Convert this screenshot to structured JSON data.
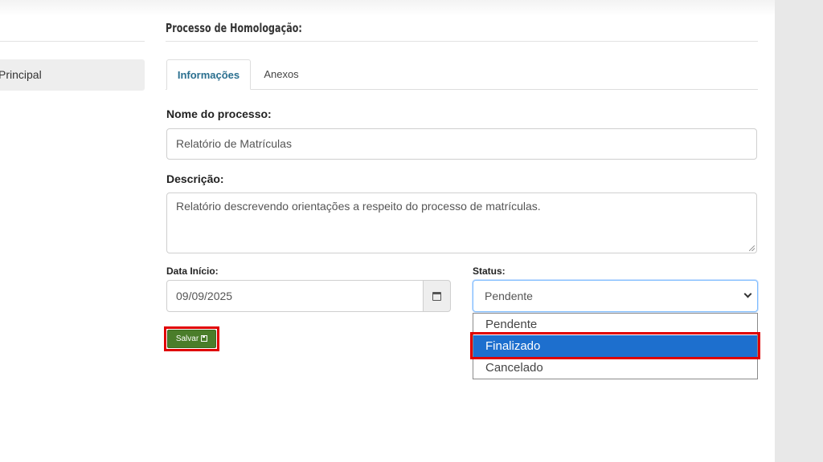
{
  "sidebar": {
    "items": [
      {
        "label": "Principal"
      }
    ]
  },
  "header": {
    "title": "Processo de Homologação:"
  },
  "tabs": [
    {
      "label": "Informações"
    },
    {
      "label": "Anexos"
    }
  ],
  "form": {
    "nome": {
      "label": "Nome do processo:",
      "value": "Relatório de Matrículas"
    },
    "descricao": {
      "label": "Descrição:",
      "value": "Relatório descrevendo orientações a respeito do processo de matrículas."
    },
    "data_inicio": {
      "label": "Data Início:",
      "value": "09/09/2025"
    },
    "status": {
      "label": "Status:",
      "value": "Pendente",
      "options": [
        "Pendente",
        "Finalizado",
        "Cancelado"
      ],
      "highlighted": "Finalizado"
    },
    "save_label": "Salvar"
  },
  "icons": {
    "calendar": "calendar-icon",
    "chevron": "chevron-down-icon",
    "save": "floppy-disk-icon"
  },
  "colors": {
    "tab_active": "#2a6f8f",
    "save_button": "#4a7d2a",
    "option_selected": "#1d6fce",
    "highlight_border": "#e00000"
  }
}
